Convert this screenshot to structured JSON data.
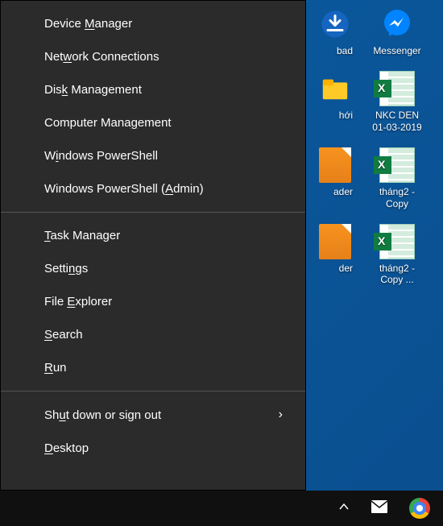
{
  "menu": {
    "section1": [
      {
        "pre": "Device ",
        "u": "M",
        "post": "anager"
      },
      {
        "pre": "Net",
        "u": "w",
        "post": "ork Connections"
      },
      {
        "pre": "Dis",
        "u": "k",
        "post": " Management"
      },
      {
        "pre": "Computer Mana",
        "u": "g",
        "post": "ement"
      },
      {
        "pre": "W",
        "u": "i",
        "post": "ndows PowerShell"
      },
      {
        "pre": "Windows PowerShell (",
        "u": "A",
        "post": "dmin)"
      }
    ],
    "section2": [
      {
        "pre": "",
        "u": "T",
        "post": "ask Manager"
      },
      {
        "pre": "Setti",
        "u": "n",
        "post": "gs"
      },
      {
        "pre": "File ",
        "u": "E",
        "post": "xplorer"
      },
      {
        "pre": "",
        "u": "S",
        "post": "earch"
      },
      {
        "pre": "",
        "u": "R",
        "post": "un"
      }
    ],
    "section3": [
      {
        "pre": "Sh",
        "u": "u",
        "post": "t down or sign out",
        "submenu": true
      },
      {
        "pre": "",
        "u": "D",
        "post": "esktop"
      }
    ]
  },
  "desktop": {
    "row1": {
      "left_label": "bad",
      "right_label": "Messenger"
    },
    "row2": {
      "left_label": "hới",
      "right_label": "NKC DEN 01-03-2019"
    },
    "row3": {
      "left_label": "ader",
      "right_label": "tháng2 - Copy"
    },
    "row4": {
      "left_label": "der",
      "right_label": "tháng2 - Copy ..."
    }
  },
  "chevron": "›"
}
